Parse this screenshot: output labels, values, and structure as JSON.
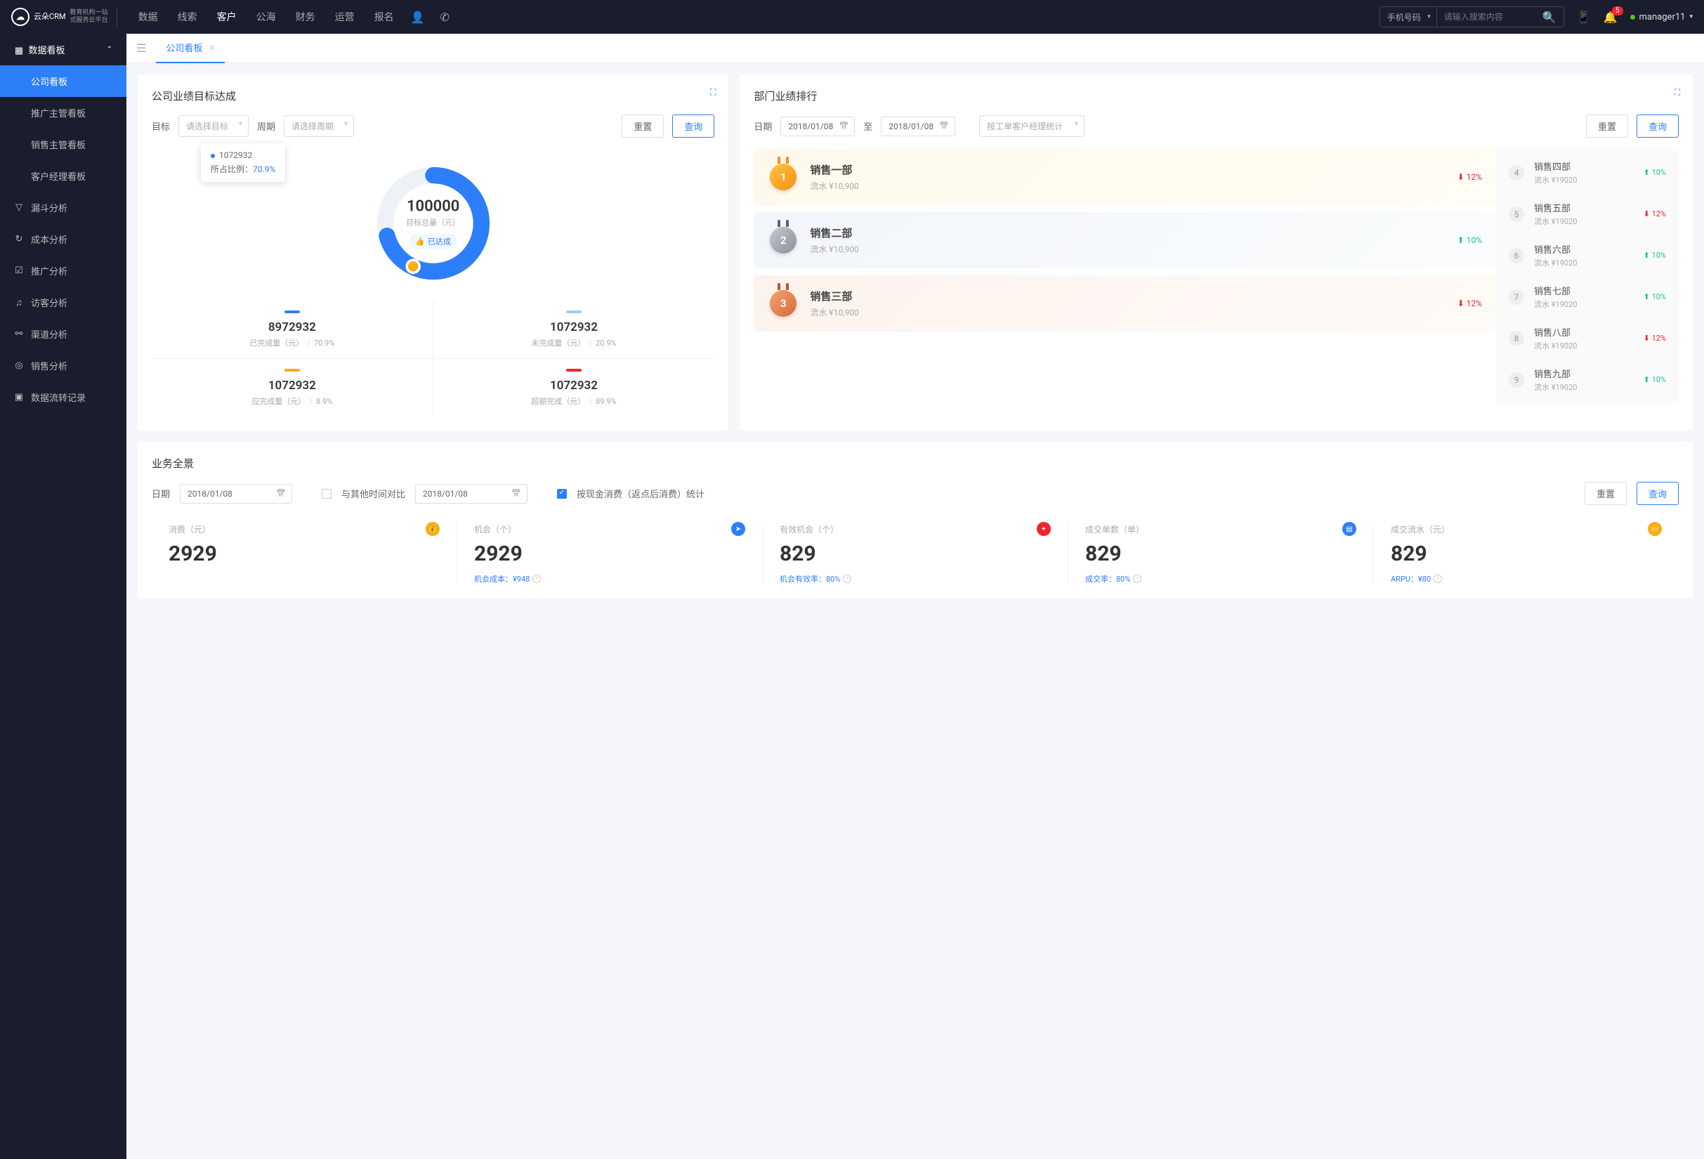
{
  "topnav": {
    "logo_main": "云朵CRM",
    "logo_sub1": "教育机构一站",
    "logo_sub2": "式服务云平台",
    "items": [
      "数据",
      "线索",
      "客户",
      "公海",
      "财务",
      "运营",
      "报名"
    ],
    "active_index": 2,
    "search_type": "手机号码",
    "search_placeholder": "请输入搜索内容",
    "notif_count": "5",
    "username": "manager11"
  },
  "sidebar": {
    "group_title": "数据看板",
    "sub_items": [
      "公司看板",
      "推广主管看板",
      "销售主管看板",
      "客户经理看板"
    ],
    "active_sub": 0,
    "items": [
      {
        "icon": "▽",
        "label": "漏斗分析"
      },
      {
        "icon": "↻",
        "label": "成本分析"
      },
      {
        "icon": "☑",
        "label": "推广分析"
      },
      {
        "icon": "♫",
        "label": "访客分析"
      },
      {
        "icon": "⚯",
        "label": "渠道分析"
      },
      {
        "icon": "◎",
        "label": "销售分析"
      },
      {
        "icon": "▣",
        "label": "数据流转记录"
      }
    ]
  },
  "tabs": {
    "active": "公司看板"
  },
  "goal_card": {
    "title": "公司业绩目标达成",
    "filter_labels": {
      "target": "目标",
      "period": "周期"
    },
    "target_placeholder": "请选择目标",
    "period_placeholder": "请选择周期",
    "reset": "重置",
    "query": "查询",
    "tooltip_val": "1072932",
    "tooltip_ratio_lbl": "所占比例：",
    "tooltip_ratio": "70.9%",
    "center_num": "100000",
    "center_lbl": "目标总量（元）",
    "center_badge": "已达成",
    "stats": [
      {
        "color": "#2d7ff9",
        "num": "8972932",
        "lbl": "已完成量（元）",
        "pct": "70.9%"
      },
      {
        "color": "#a5c8ff",
        "num": "1072932",
        "lbl": "未完成量（元）",
        "pct": "20.9%"
      },
      {
        "color": "#faad14",
        "num": "1072932",
        "lbl": "应完成量（元）",
        "pct": "8.9%"
      },
      {
        "color": "#f5222d",
        "num": "1072932",
        "lbl": "超额完成（元）",
        "pct": "89.9%"
      }
    ]
  },
  "rank_card": {
    "title": "部门业绩排行",
    "date_lbl": "日期",
    "date_from": "2018/01/08",
    "date_sep": "至",
    "date_to": "2018/01/08",
    "stat_type": "按工单客户经理统计",
    "reset": "重置",
    "query": "查询",
    "top3": [
      {
        "rank": "1",
        "name": "销售一部",
        "sub": "流水 ¥10,900",
        "pct": "12%",
        "dir": "down"
      },
      {
        "rank": "2",
        "name": "销售二部",
        "sub": "流水 ¥10,900",
        "pct": "10%",
        "dir": "up"
      },
      {
        "rank": "3",
        "name": "销售三部",
        "sub": "流水 ¥10,900",
        "pct": "12%",
        "dir": "down"
      }
    ],
    "list": [
      {
        "rank": "4",
        "name": "销售四部",
        "sub": "流水 ¥19020",
        "pct": "10%",
        "dir": "up"
      },
      {
        "rank": "5",
        "name": "销售五部",
        "sub": "流水 ¥19020",
        "pct": "12%",
        "dir": "down"
      },
      {
        "rank": "6",
        "name": "销售六部",
        "sub": "流水 ¥19020",
        "pct": "10%",
        "dir": "up"
      },
      {
        "rank": "7",
        "name": "销售七部",
        "sub": "流水 ¥19020",
        "pct": "10%",
        "dir": "up"
      },
      {
        "rank": "8",
        "name": "销售八部",
        "sub": "流水 ¥19020",
        "pct": "12%",
        "dir": "down"
      },
      {
        "rank": "9",
        "name": "销售九部",
        "sub": "流水 ¥19020",
        "pct": "10%",
        "dir": "up"
      }
    ]
  },
  "biz_card": {
    "title": "业务全景",
    "date_lbl": "日期",
    "date1": "2018/01/08",
    "compare_lbl": "与其他时间对比",
    "date2": "2018/01/08",
    "checkbox_lbl": "按现金消费（返点后消费）统计",
    "reset": "重置",
    "query": "查询",
    "stats": [
      {
        "lbl": "消费（元）",
        "num": "2929",
        "icon": "💰",
        "icon_bg": "#faad14",
        "sub": ""
      },
      {
        "lbl": "机会（个）",
        "num": "2929",
        "icon": "➤",
        "icon_bg": "#2d7ff9",
        "sub_lbl": "机会成本：",
        "sub_val": "¥948"
      },
      {
        "lbl": "有效机会（个）",
        "num": "829",
        "icon": "✦",
        "icon_bg": "#f5222d",
        "sub_lbl": "机会有效率：",
        "sub_val": "80%"
      },
      {
        "lbl": "成交单数（单）",
        "num": "829",
        "icon": "▤",
        "icon_bg": "#2d7ff9",
        "sub_lbl": "成交率：",
        "sub_val": "80%"
      },
      {
        "lbl": "成交流水（元）",
        "num": "829",
        "icon": "▭",
        "icon_bg": "#faad14",
        "sub_lbl": "ARPU：",
        "sub_val": "¥80"
      }
    ]
  },
  "chart_data": {
    "type": "pie",
    "title": "公司业绩目标达成",
    "total_label": "目标总量（元）",
    "total": 100000,
    "series": [
      {
        "name": "已完成量（元）",
        "value": 8972932,
        "pct": 70.9,
        "color": "#2d7ff9"
      },
      {
        "name": "未完成量（元）",
        "value": 1072932,
        "pct": 20.9,
        "color": "#a5c8ff"
      },
      {
        "name": "应完成量（元）",
        "value": 1072932,
        "pct": 8.9,
        "color": "#faad14"
      },
      {
        "name": "超额完成（元）",
        "value": 1072932,
        "pct": 89.9,
        "color": "#f5222d"
      }
    ]
  }
}
